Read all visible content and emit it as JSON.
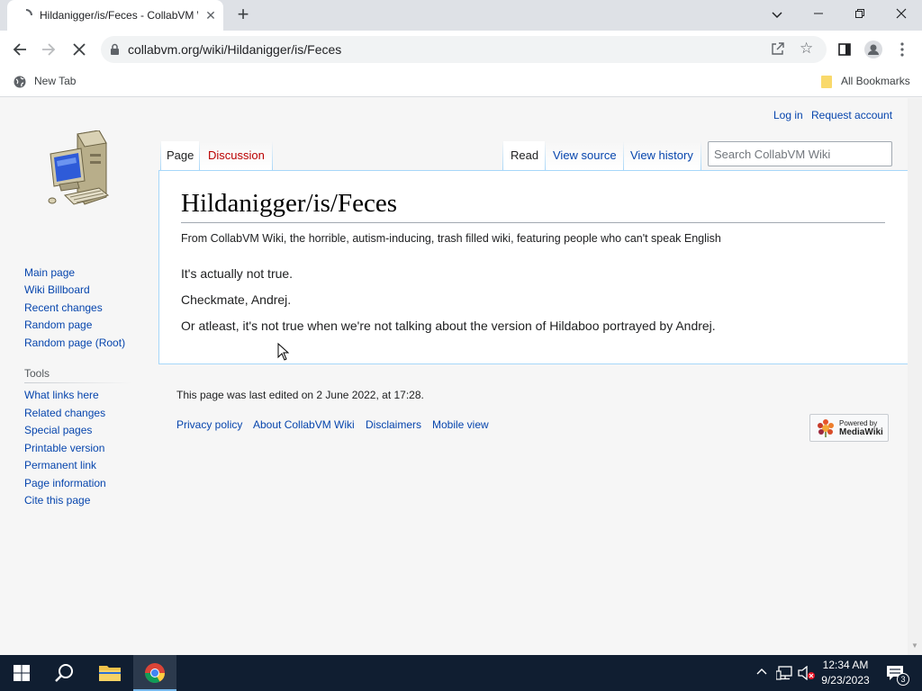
{
  "browser": {
    "tab_title": "Hildanigger/is/Feces - CollabVM Wiki",
    "url": "collabvm.org/wiki/Hildanigger/is/Feces",
    "bookmarks": {
      "new_tab": "New Tab",
      "all_bookmarks": "All Bookmarks"
    }
  },
  "wiki": {
    "personal": {
      "login": "Log in",
      "request_account": "Request account"
    },
    "tabs": {
      "page": "Page",
      "discussion": "Discussion",
      "read": "Read",
      "view_source": "View source",
      "view_history": "View history"
    },
    "search_placeholder": "Search CollabVM Wiki",
    "nav": [
      "Main page",
      "Wiki Billboard",
      "Recent changes",
      "Random page",
      "Random page (Root)"
    ],
    "tools_heading": "Tools",
    "tools": [
      "What links here",
      "Related changes",
      "Special pages",
      "Printable version",
      "Permanent link",
      "Page information",
      "Cite this page"
    ],
    "title": "Hildanigger/is/Feces",
    "site_sub": "From CollabVM Wiki, the horrible, autism-inducing, trash filled wiki, featuring people who can't speak English",
    "paragraphs": [
      "It's actually not true.",
      "Checkmate, Andrej.",
      "Or atleast, it's not true when we're not talking about the version of Hildaboo portrayed by Andrej."
    ],
    "footer_info": "This page was last edited on 2 June 2022, at 17:28.",
    "footer_links": [
      "Privacy policy",
      "About CollabVM Wiki",
      "Disclaimers",
      "Mobile view"
    ],
    "powered_by": {
      "line1": "Powered by",
      "line2": "MediaWiki"
    }
  },
  "taskbar": {
    "time": "12:34 AM",
    "date": "9/23/2023",
    "notification_count": "3"
  }
}
